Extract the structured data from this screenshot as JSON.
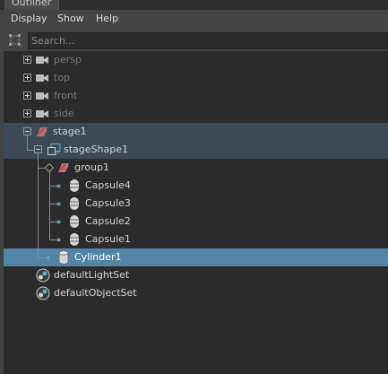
{
  "window": {
    "tab_title": "Outliner"
  },
  "menubar": {
    "display": "Display",
    "show": "Show",
    "help": "Help"
  },
  "search": {
    "placeholder": "Search..."
  },
  "tree": {
    "persp": "persp",
    "top": "top",
    "front": "front",
    "side": "side",
    "stage1": "stage1",
    "stageShape1": "stageShape1",
    "group1": "group1",
    "capsule4": "Capsule4",
    "capsule3": "Capsule3",
    "capsule2": "Capsule2",
    "capsule1": "Capsule1",
    "cylinder1": "Cylinder1",
    "defaultLightSet": "defaultLightSet",
    "defaultObjectSet": "defaultObjectSet"
  },
  "colors": {
    "selection": "#5285a6",
    "parent_highlight": "#3d4955",
    "connector": "#8a8a8a",
    "connector_dot": "#4fa8c8"
  },
  "icons": {
    "cameras": "camera-icon",
    "stage": "stage-icon",
    "shape": "shape-icon",
    "group": "transform-group-icon",
    "prim": "capsule-cylinder-icon",
    "set": "object-set-icon"
  }
}
